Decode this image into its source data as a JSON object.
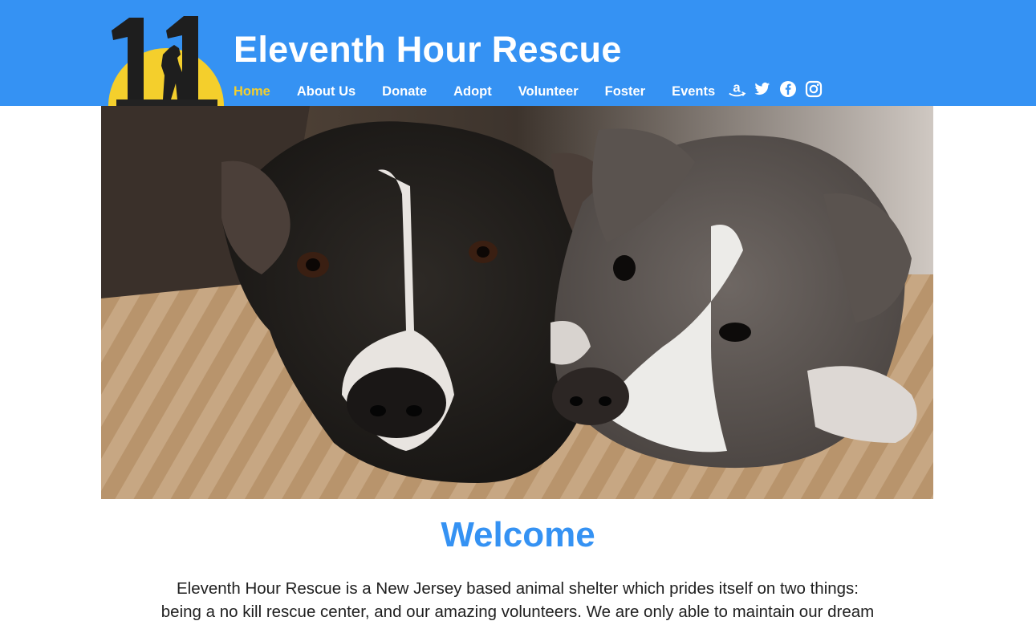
{
  "site": {
    "title": "Eleventh Hour Rescue",
    "logo_text": "11"
  },
  "nav": {
    "items": [
      {
        "label": "Home",
        "active": true
      },
      {
        "label": "About Us"
      },
      {
        "label": "Donate"
      },
      {
        "label": "Adopt"
      },
      {
        "label": "Volunteer"
      },
      {
        "label": "Foster"
      },
      {
        "label": "Events"
      }
    ]
  },
  "social": {
    "icons": [
      "amazon-icon",
      "twitter-icon",
      "facebook-icon",
      "instagram-icon"
    ]
  },
  "welcome": {
    "heading": "Welcome",
    "text": "Eleventh Hour Rescue is a New Jersey based animal shelter which prides itself on two things: being a no kill rescue center, and our amazing volunteers. We are only able to maintain our dream of"
  },
  "colors": {
    "header_bg": "#3592f3",
    "accent_yellow": "#f4cf2c",
    "heading_blue": "#3592f3"
  }
}
